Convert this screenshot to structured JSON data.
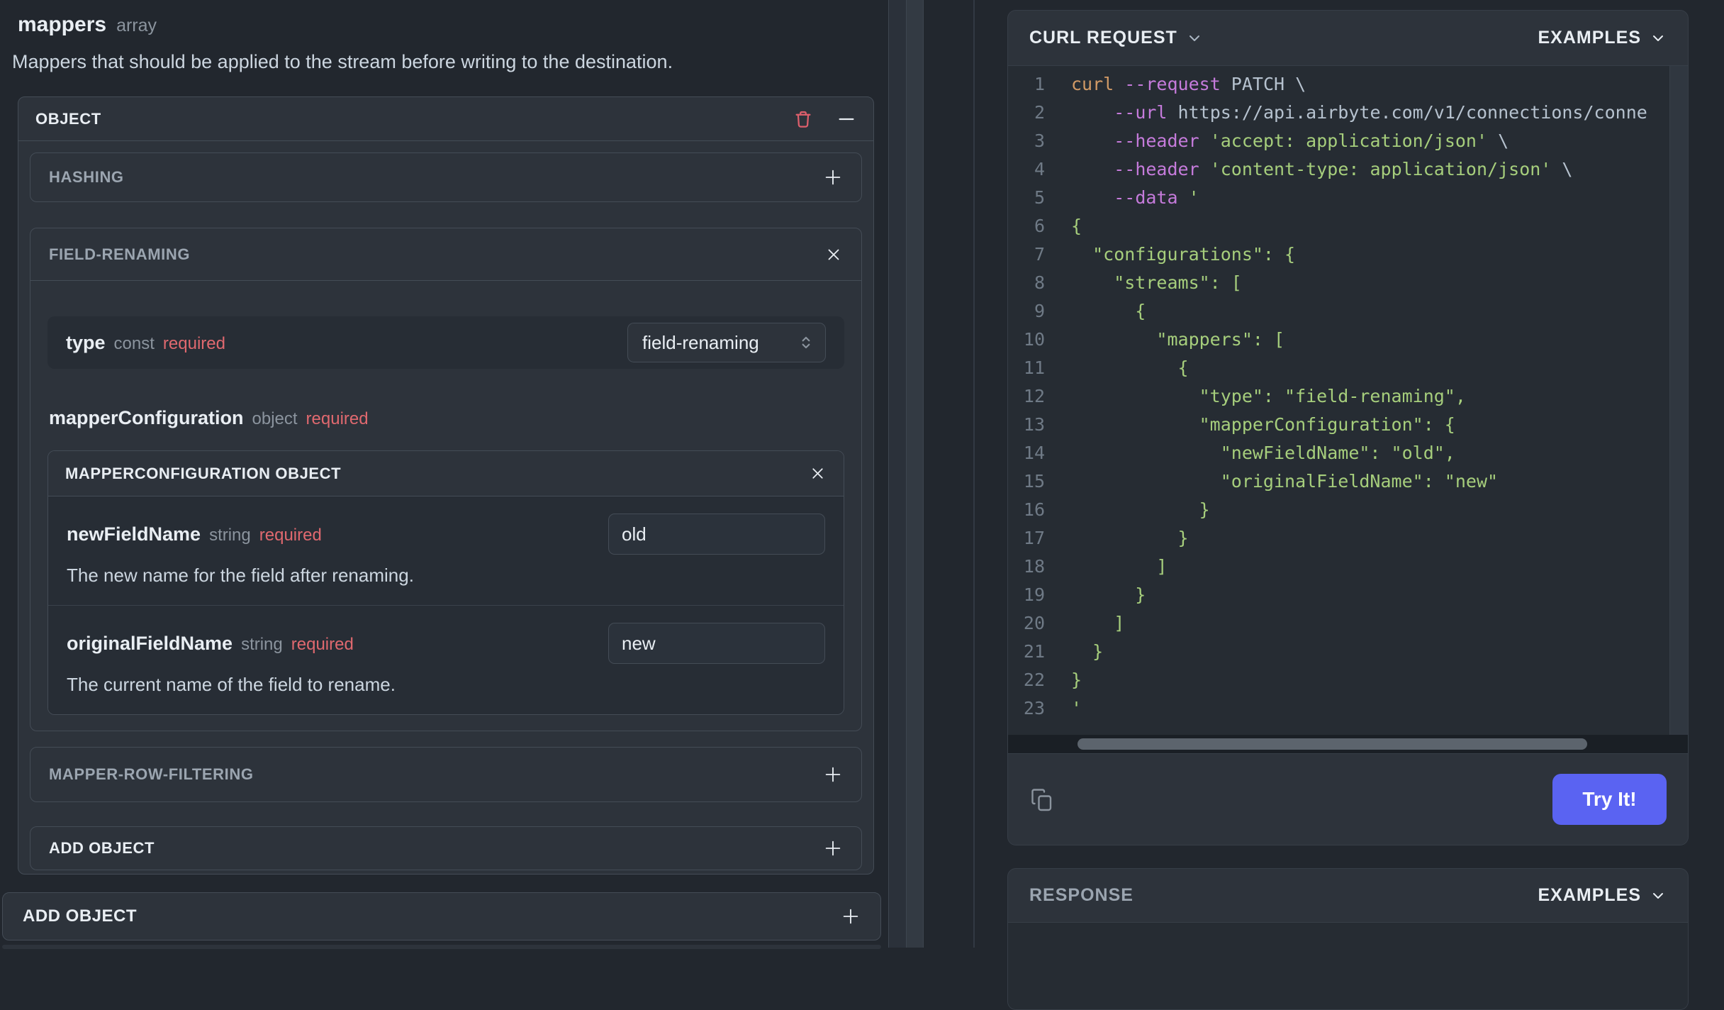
{
  "left_panel": {
    "title": "mappers",
    "title_type": "array",
    "description": "Mappers that should be applied to the stream before writing to the destination.",
    "object_section": {
      "header": "OBJECT",
      "hashing": {
        "label": "HASHING",
        "action": "+"
      },
      "field_renaming": {
        "label": "FIELD-RENAMING",
        "type_row": {
          "name": "type",
          "kind": "const",
          "required": "required",
          "select_value": "field-renaming"
        },
        "mapper_configuration_label": {
          "name": "mapperConfiguration",
          "kind": "object",
          "required": "required"
        },
        "mc_object": {
          "header": "MAPPERCONFIGURATION OBJECT",
          "fields": [
            {
              "name": "newFieldName",
              "kind": "string",
              "required": "required",
              "value": "old",
              "description": "The new name for the field after renaming."
            },
            {
              "name": "originalFieldName",
              "kind": "string",
              "required": "required",
              "value": "new",
              "description": "The current name of the field to rename."
            }
          ]
        }
      },
      "mapper_row_filtering": {
        "label": "MAPPER-ROW-FILTERING",
        "action": "+"
      },
      "add_object": {
        "label": "ADD OBJECT",
        "action": "+"
      }
    },
    "outer_add_object": {
      "label": "ADD OBJECT",
      "action": "+"
    }
  },
  "request_panel": {
    "title": "CURL REQUEST",
    "examples_label": "EXAMPLES",
    "try_button": "Try It!",
    "code_lines": [
      {
        "num": 1,
        "segments": [
          {
            "t": "cmd",
            "text": "curl"
          },
          {
            "t": "plain",
            "text": " "
          },
          {
            "t": "flag",
            "text": "--request"
          },
          {
            "t": "plain",
            "text": " PATCH \\"
          }
        ]
      },
      {
        "num": 2,
        "segments": [
          {
            "t": "plain",
            "text": "    "
          },
          {
            "t": "flag",
            "text": "--url"
          },
          {
            "t": "plain",
            "text": " https://api.airbyte.com/v1/connections/conne"
          }
        ]
      },
      {
        "num": 3,
        "segments": [
          {
            "t": "plain",
            "text": "    "
          },
          {
            "t": "flag",
            "text": "--header"
          },
          {
            "t": "plain",
            "text": " "
          },
          {
            "t": "str",
            "text": "'accept: application/json'"
          },
          {
            "t": "plain",
            "text": " \\"
          }
        ]
      },
      {
        "num": 4,
        "segments": [
          {
            "t": "plain",
            "text": "    "
          },
          {
            "t": "flag",
            "text": "--header"
          },
          {
            "t": "plain",
            "text": " "
          },
          {
            "t": "str",
            "text": "'content-type: application/json'"
          },
          {
            "t": "plain",
            "text": " \\"
          }
        ]
      },
      {
        "num": 5,
        "segments": [
          {
            "t": "plain",
            "text": "    "
          },
          {
            "t": "flag",
            "text": "--data"
          },
          {
            "t": "plain",
            "text": " "
          },
          {
            "t": "str",
            "text": "'"
          }
        ]
      },
      {
        "num": 6,
        "segments": [
          {
            "t": "json",
            "text": "{"
          }
        ]
      },
      {
        "num": 7,
        "segments": [
          {
            "t": "json",
            "text": "  \"configurations\": {"
          }
        ]
      },
      {
        "num": 8,
        "segments": [
          {
            "t": "json",
            "text": "    \"streams\": ["
          }
        ]
      },
      {
        "num": 9,
        "segments": [
          {
            "t": "json",
            "text": "      {"
          }
        ]
      },
      {
        "num": 10,
        "segments": [
          {
            "t": "json",
            "text": "        \"mappers\": ["
          }
        ]
      },
      {
        "num": 11,
        "segments": [
          {
            "t": "json",
            "text": "          {"
          }
        ]
      },
      {
        "num": 12,
        "segments": [
          {
            "t": "json",
            "text": "            \"type\": \"field-renaming\","
          }
        ]
      },
      {
        "num": 13,
        "segments": [
          {
            "t": "json",
            "text": "            \"mapperConfiguration\": {"
          }
        ]
      },
      {
        "num": 14,
        "segments": [
          {
            "t": "json",
            "text": "              \"newFieldName\": \"old\","
          }
        ]
      },
      {
        "num": 15,
        "segments": [
          {
            "t": "json",
            "text": "              \"originalFieldName\": \"new\""
          }
        ]
      },
      {
        "num": 16,
        "segments": [
          {
            "t": "json",
            "text": "            }"
          }
        ]
      },
      {
        "num": 17,
        "segments": [
          {
            "t": "json",
            "text": "          }"
          }
        ]
      },
      {
        "num": 18,
        "segments": [
          {
            "t": "json",
            "text": "        ]"
          }
        ]
      },
      {
        "num": 19,
        "segments": [
          {
            "t": "json",
            "text": "      }"
          }
        ]
      },
      {
        "num": 20,
        "segments": [
          {
            "t": "json",
            "text": "    ]"
          }
        ]
      },
      {
        "num": 21,
        "segments": [
          {
            "t": "json",
            "text": "  }"
          }
        ]
      },
      {
        "num": 22,
        "segments": [
          {
            "t": "json",
            "text": "}"
          }
        ]
      },
      {
        "num": 23,
        "segments": [
          {
            "t": "json",
            "text": "'"
          }
        ]
      }
    ]
  },
  "response_panel": {
    "title": "RESPONSE",
    "examples_label": "EXAMPLES"
  },
  "icons": {
    "delete": "trash-icon",
    "collapse": "minus-icon",
    "expand": "plus-icon",
    "close": "close-icon",
    "select_stepper": "up-down-chevrons-icon",
    "dropdown": "chevron-down-icon",
    "copy": "copy-icon"
  },
  "colors": {
    "page_bg": "#22272e",
    "panel_bg": "#2d333b",
    "inner_row_bg": "#272d35",
    "border": "#444c56",
    "muted_text": "#8b949e",
    "required_red": "#e0696f",
    "code_bg": "#262c33",
    "code_orange": "#d19a66",
    "code_purple": "#c57bdb",
    "code_green": "#a6ce7c",
    "code_plain": "#b6c2cf",
    "try_button": "#5a63f2"
  }
}
